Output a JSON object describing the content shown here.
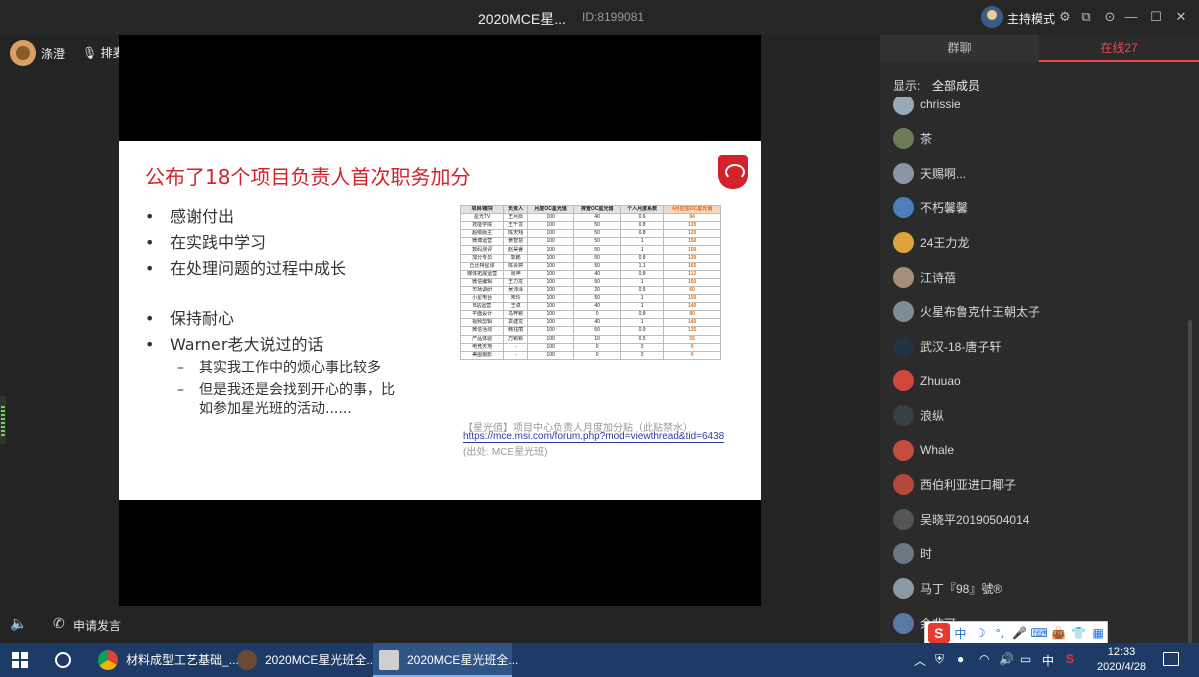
{
  "titlebar": {
    "title": "2020MCE星...",
    "room_id": "ID:8199081",
    "host_mode": "主持模式",
    "icons": [
      "settings-icon",
      "popout-icon",
      "minimize-icon",
      "maximize-icon",
      "close-icon"
    ]
  },
  "stage": {
    "user_name": "涤澄",
    "mic_label": "排麦"
  },
  "slide": {
    "heading": "公布了18个项目负责人首次职务加分",
    "bullets": [
      "感谢付出",
      "在实践中学习",
      "在处理问题的过程中成长",
      "保持耐心",
      "Warner老大说过的话"
    ],
    "sub_bullets": [
      "其实我工作中的烦心事比较多",
      "但是我还是会找到开心的事，比",
      "如参加星光班的活动......"
    ],
    "table_headers": [
      "项目/模块",
      "负责人",
      "月度OC星光值",
      "排查OC星光值",
      "个人月度系数",
      "4月应加OC星光值"
    ],
    "table_rows": [
      [
        "星光TV",
        "王月辰",
        "100",
        "40",
        "0.6",
        "84"
      ],
      [
        "技能学院",
        "王千龙",
        "100",
        "50",
        "0.8",
        "120"
      ],
      [
        "超级版主",
        "陈天翔",
        "100",
        "50",
        "0.8",
        "120"
      ],
      [
        "微博运营",
        "黄智慧",
        "100",
        "50",
        "1",
        "150"
      ],
      [
        "数码测评",
        "赵昊睿",
        "100",
        "50",
        "1",
        "150"
      ],
      [
        "加分专员",
        "郭鹏",
        "100",
        "50",
        "0.8",
        "120"
      ],
      [
        "丘比特星球",
        "陈青婷",
        "100",
        "50",
        "1.1",
        "165"
      ],
      [
        "媒体拓展运营",
        "周坤",
        "100",
        "40",
        "0.8",
        "112"
      ],
      [
        "微信编辑",
        "王力龙",
        "100",
        "50",
        "1",
        "150"
      ],
      [
        "市场调研",
        "吴沛泽",
        "100",
        "20",
        "0.5",
        "60"
      ],
      [
        "小星电台",
        "朱玲",
        "100",
        "50",
        "1",
        "150"
      ],
      [
        "B站运营",
        "王卓",
        "100",
        "40",
        "1",
        "140"
      ],
      [
        "平面设计",
        "马梓颖",
        "100",
        "0",
        "0.8",
        "80"
      ],
      [
        "视频剪辑",
        "袁建龙",
        "100",
        "40",
        "1",
        "140"
      ],
      [
        "微信活动",
        "韩钰丽",
        "100",
        "50",
        "0.9",
        "135"
      ],
      [
        "产品体验",
        "万颖颖",
        "100",
        "10",
        "0.5",
        "55"
      ],
      [
        "电竞天地",
        "-",
        "100",
        "0",
        "0",
        "0"
      ],
      [
        "美图摄影",
        "-",
        "100",
        "0",
        "0",
        "0"
      ]
    ],
    "source_title": "【星光值】项目中心负责人月度加分贴（此贴禁水）",
    "source_link": "https://mce.msi.com/forum.php?mod=viewthread&tid=6438",
    "source_note": "(出处: MCE星光班)"
  },
  "controls": {
    "request_speak": "申请发言"
  },
  "sidebar": {
    "tabs": [
      "群聊",
      "在线27"
    ],
    "filter_label": "显示:",
    "filter_value": "全部成员",
    "members": [
      {
        "name": "chrissie",
        "color": "#9aa9b6"
      },
      {
        "name": "茶",
        "color": "#6b7c5a"
      },
      {
        "name": "天赐啊...",
        "color": "#8a96a4"
      },
      {
        "name": "不朽馨馨",
        "color": "#4f7fb8"
      },
      {
        "name": "24王力龙",
        "color": "#e0a23c"
      },
      {
        "name": "江诗蓓",
        "color": "#a58f7a"
      },
      {
        "name": "火星布鲁克什王朝太子",
        "color": "#7e8c93"
      },
      {
        "name": "武汉-18-唐子轩",
        "color": "#233344"
      },
      {
        "name": "Zhuuao",
        "color": "#d2473b"
      },
      {
        "name": "浪纵",
        "color": "#3b4048"
      },
      {
        "name": "Whale",
        "color": "#c44b3d"
      },
      {
        "name": "西伯利亚进口椰子",
        "color": "#b5473d"
      },
      {
        "name": "吴晓平20190504014",
        "color": "#555555"
      },
      {
        "name": "时",
        "color": "#6d7683"
      },
      {
        "name": "马丁『98』號®",
        "color": "#8c9aa6"
      },
      {
        "name": "余非可",
        "color": "#5a7aa6"
      }
    ]
  },
  "ime": {
    "items": [
      "中",
      "☽",
      "°,",
      "🎤",
      "⌨",
      "👜",
      "👕",
      "▦"
    ]
  },
  "taskbar": {
    "tasks": [
      "材料成型工艺基础_...",
      "2020MCE星光班全...",
      "2020MCE星光班全..."
    ],
    "tray_lang": "中",
    "time": "12:33",
    "date": "2020/4/28"
  }
}
